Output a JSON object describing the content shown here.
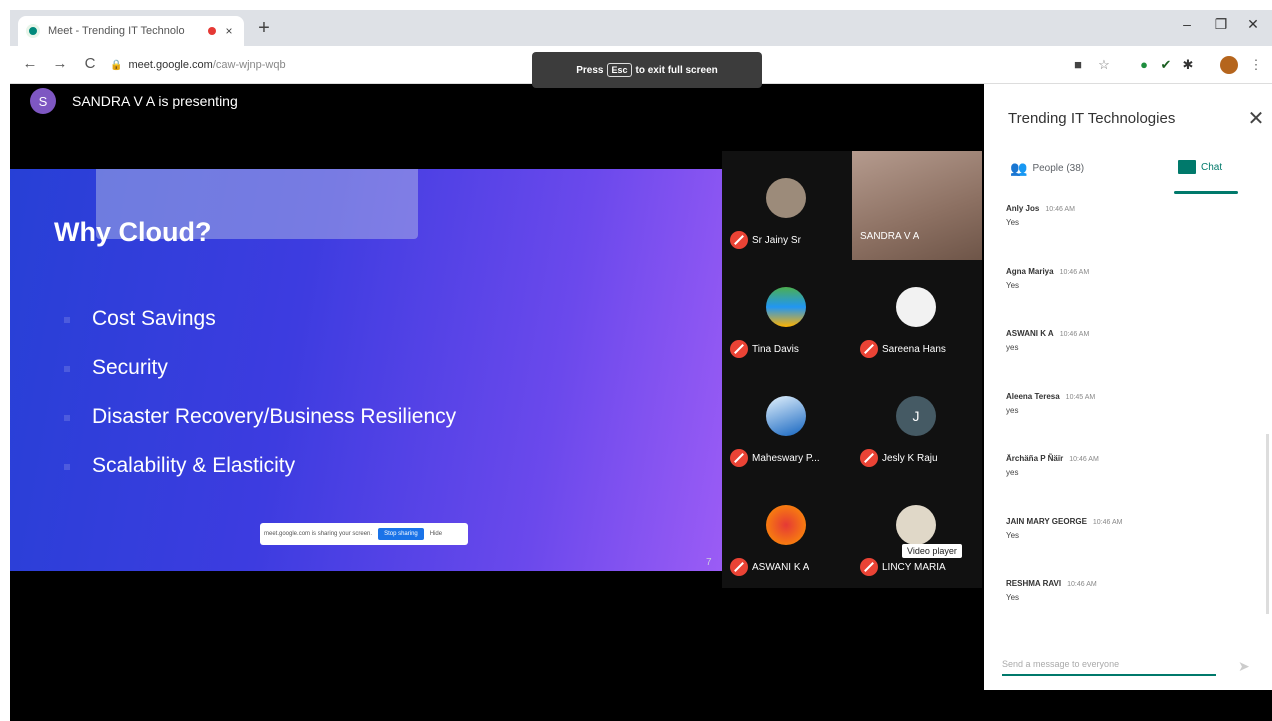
{
  "browser": {
    "tab_title": "Meet - Trending IT Technolo",
    "tab_close": "×",
    "new_tab": "+",
    "window_controls": [
      "–",
      "❐",
      "✕"
    ],
    "nav": {
      "back": "←",
      "forward": "→",
      "reload": "C"
    },
    "url_host": "meet.google.com",
    "url_path": "/caw-wjnp-wqb",
    "lock_icon": "🔒"
  },
  "fullscreen_toast": {
    "pre": "Press",
    "key": "Esc",
    "post": "to exit full screen"
  },
  "presenter": {
    "initial": "S",
    "text": "SANDRA V A is presenting"
  },
  "slide": {
    "title": "Why Cloud?",
    "bullets": [
      "Cost Savings",
      "Security",
      "Disaster Recovery/Business Resiliency",
      "Scalability & Elasticity"
    ],
    "share_text": "meet.google.com is sharing your screen.",
    "stop_label": "Stop sharing",
    "hide_label": "Hide",
    "page_number": "7"
  },
  "participants": [
    {
      "name": "Sr Jainy Sr",
      "avatar": ""
    },
    {
      "name": "SANDRA V A",
      "avatar": ""
    },
    {
      "name": "Tina Davis",
      "avatar": ""
    },
    {
      "name": "Sareena Hans",
      "avatar": ""
    },
    {
      "name": "Maheswary P...",
      "avatar": ""
    },
    {
      "name": "Jesly K Raju",
      "avatar": "J"
    },
    {
      "name": "ASWANI K A",
      "avatar": ""
    },
    {
      "name": "LINCY MARIA",
      "avatar": ""
    }
  ],
  "tooltip": "Video player",
  "panel": {
    "title": "Trending IT Technologies",
    "close": "✕",
    "people_tab": "People (38)",
    "chat_tab": "Chat",
    "messages": [
      {
        "sender": "Anly Jos",
        "time": "10:46 AM",
        "text": "Yes"
      },
      {
        "sender": "Agna Mariya",
        "time": "10:46 AM",
        "text": "Yes"
      },
      {
        "sender": "ASWANI K A",
        "time": "10:46 AM",
        "text": "yes"
      },
      {
        "sender": "Aleena Teresa",
        "time": "10:45 AM",
        "text": "yes"
      },
      {
        "sender": "Ärchäña P Ñäïr",
        "time": "10:46 AM",
        "text": "yes"
      },
      {
        "sender": "JAIN MARY GEORGE",
        "time": "10:46 AM",
        "text": "Yes"
      },
      {
        "sender": "RESHMA RAVI",
        "time": "10:46 AM",
        "text": "Yes"
      }
    ],
    "input_placeholder": "Send a message to everyone",
    "send_icon": "➤"
  }
}
